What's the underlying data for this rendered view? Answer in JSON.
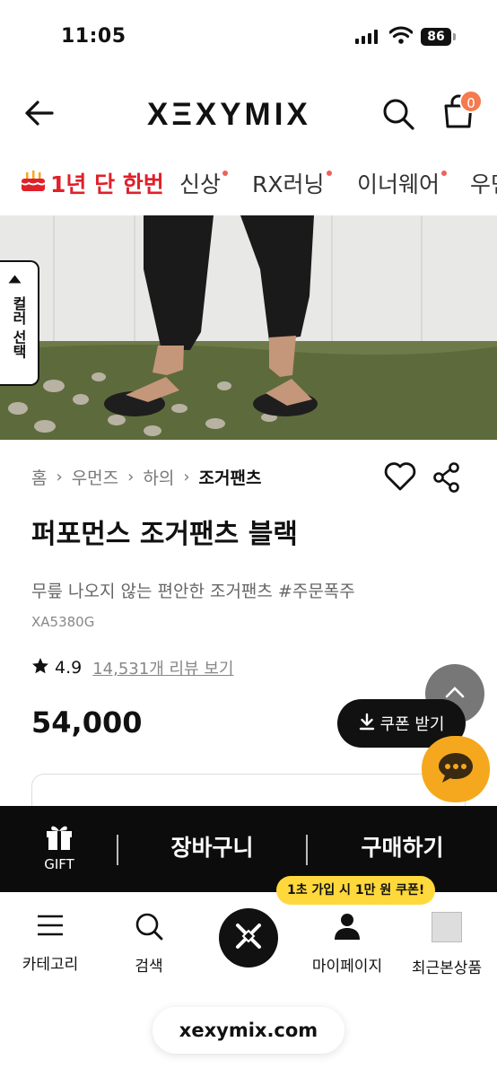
{
  "status_bar": {
    "time": "11:05",
    "battery": "86"
  },
  "header": {
    "logo": "XΞXYMIX",
    "cart_count": "0"
  },
  "category_nav": {
    "promo_label": "1년 단 한번",
    "items": [
      "신상",
      "RX러닝",
      "이너웨어",
      "우먼"
    ]
  },
  "color_tab": {
    "label": "컬러 선택"
  },
  "breadcrumb": [
    "홈",
    "우먼즈",
    "하의",
    "조거팬츠"
  ],
  "product": {
    "title": "퍼포먼스 조거팬츠 블랙",
    "subtitle": "무릎 나오지 않는 편안한 조거팬츠 #주문폭주",
    "sku": "XA5380G",
    "rating": "4.9",
    "reviews": "14,531개 리뷰 보기",
    "price": "54,000"
  },
  "coupon_button": {
    "label": "쿠폰 받기"
  },
  "purchase_bar": {
    "gift_label": "GIFT",
    "cart_label": "장바구니",
    "buy_label": "구매하기"
  },
  "signup_tip": "1초 가입 시 1만 원 쿠폰!",
  "tab_bar": {
    "items": [
      "카테고리",
      "검색",
      "마이페이지",
      "최근본상품"
    ]
  },
  "browser": {
    "url": "xexymix.com"
  },
  "colors": {
    "accent": "#f47a4f",
    "promo": "#e0202a",
    "chat": "#f5a81d",
    "tip": "#ffd93b"
  },
  "icons": [
    "back-arrow-icon",
    "search-icon",
    "shopping-bag-icon",
    "cake-icon",
    "heart-icon",
    "share-icon",
    "star-icon",
    "download-icon",
    "chevron-up-icon",
    "chat-icon",
    "gift-icon",
    "menu-icon",
    "user-icon",
    "xexymix-logo-icon"
  ]
}
